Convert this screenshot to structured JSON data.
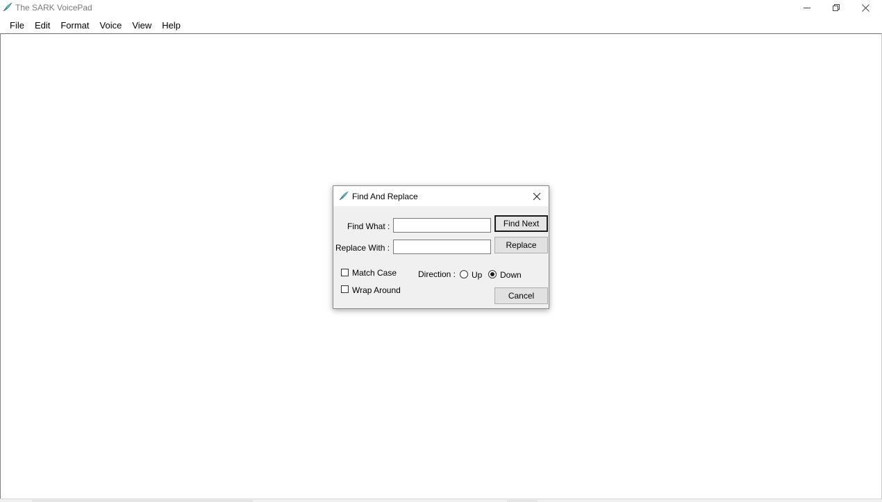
{
  "window": {
    "title": "The SARK VoicePad",
    "controls": {
      "minimize": "minimize-icon",
      "maximize": "restore-icon",
      "close": "close-icon"
    }
  },
  "menu": {
    "items": [
      {
        "label": "File"
      },
      {
        "label": "Edit"
      },
      {
        "label": "Format"
      },
      {
        "label": "Voice"
      },
      {
        "label": "View"
      },
      {
        "label": "Help"
      }
    ]
  },
  "editor": {
    "text": ""
  },
  "dialog": {
    "title": "Find And Replace",
    "find_label": "Find What :",
    "find_value": "",
    "replace_label": "Replace With :",
    "replace_value": "",
    "find_next_label": "Find Next",
    "replace_label_btn": "Replace",
    "cancel_label": "Cancel",
    "match_case_label": "Match Case",
    "match_case_checked": false,
    "wrap_around_label": "Wrap Around",
    "wrap_around_checked": false,
    "direction_label": "Direction :",
    "direction_up_label": "Up",
    "direction_down_label": "Down",
    "direction_selected": "Down"
  },
  "colors": {
    "dialog_bg": "#f0f0f0",
    "title_gray": "#7a7a7a",
    "icon_teal": "#4aa3a0",
    "icon_green": "#5cb85c"
  }
}
